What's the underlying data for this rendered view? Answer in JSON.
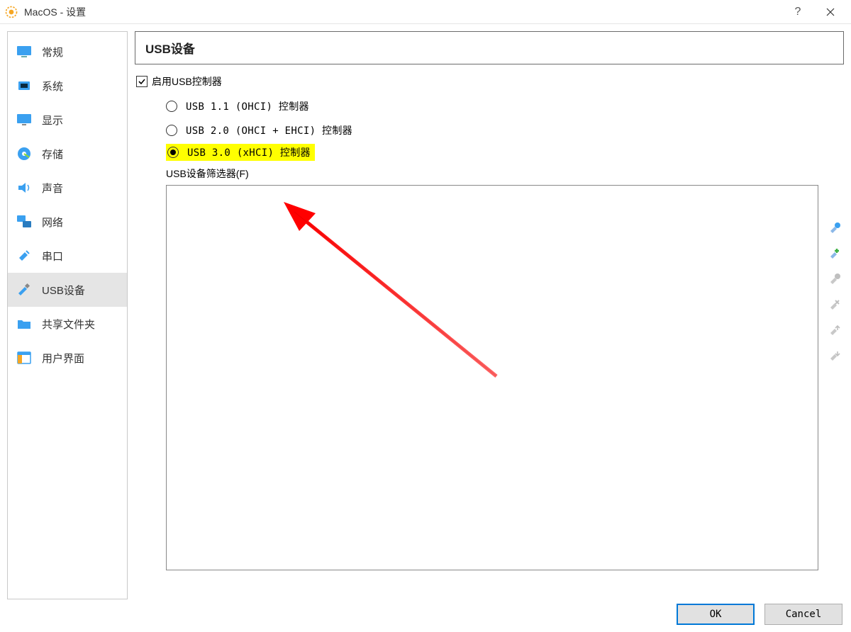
{
  "window": {
    "title": "MacOS - 设置"
  },
  "sidebar": {
    "items": [
      {
        "label": "常规"
      },
      {
        "label": "系统"
      },
      {
        "label": "显示"
      },
      {
        "label": "存储"
      },
      {
        "label": "声音"
      },
      {
        "label": "网络"
      },
      {
        "label": "串口"
      },
      {
        "label": "USB设备"
      },
      {
        "label": "共享文件夹"
      },
      {
        "label": "用户界面"
      }
    ]
  },
  "panel": {
    "title": "USB设备",
    "enable_label": "启用USB控制器",
    "radios": {
      "r1": "USB 1.1 (OHCI) 控制器",
      "r2": "USB 2.0 (OHCI + EHCI) 控制器",
      "r3": "USB 3.0 (xHCI) 控制器"
    },
    "filter_label": "USB设备筛选器(F)"
  },
  "buttons": {
    "ok": "OK",
    "cancel": "Cancel"
  }
}
